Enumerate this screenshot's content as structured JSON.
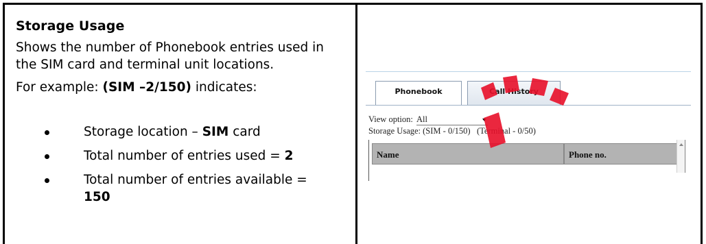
{
  "left": {
    "heading": "Storage Usage",
    "paragraph": "Shows the number of Phonebook entries used in the SIM card and terminal unit locations.",
    "example_prefix": "For example: ",
    "example_code": "(SIM –2/150)",
    "example_suffix": " indicates:",
    "bullets": [
      {
        "text": "Storage location – ",
        "bold": "SIM",
        "rest": " card"
      },
      {
        "text": "Total number of entries used = ",
        "bold": "2",
        "rest": ""
      },
      {
        "text": "Total number of entries available = ",
        "bold": "150",
        "rest": ""
      }
    ]
  },
  "screenshot": {
    "tabs": [
      "Phonebook",
      "Call History"
    ],
    "view_option_label": "View option:",
    "view_option_value": "All",
    "storage_usage": "Storage Usage: (SIM - 0/150)   (Terminal - 0/50)",
    "columns": [
      "Name",
      "Phone no."
    ],
    "watermark_color": "#e8102a"
  }
}
